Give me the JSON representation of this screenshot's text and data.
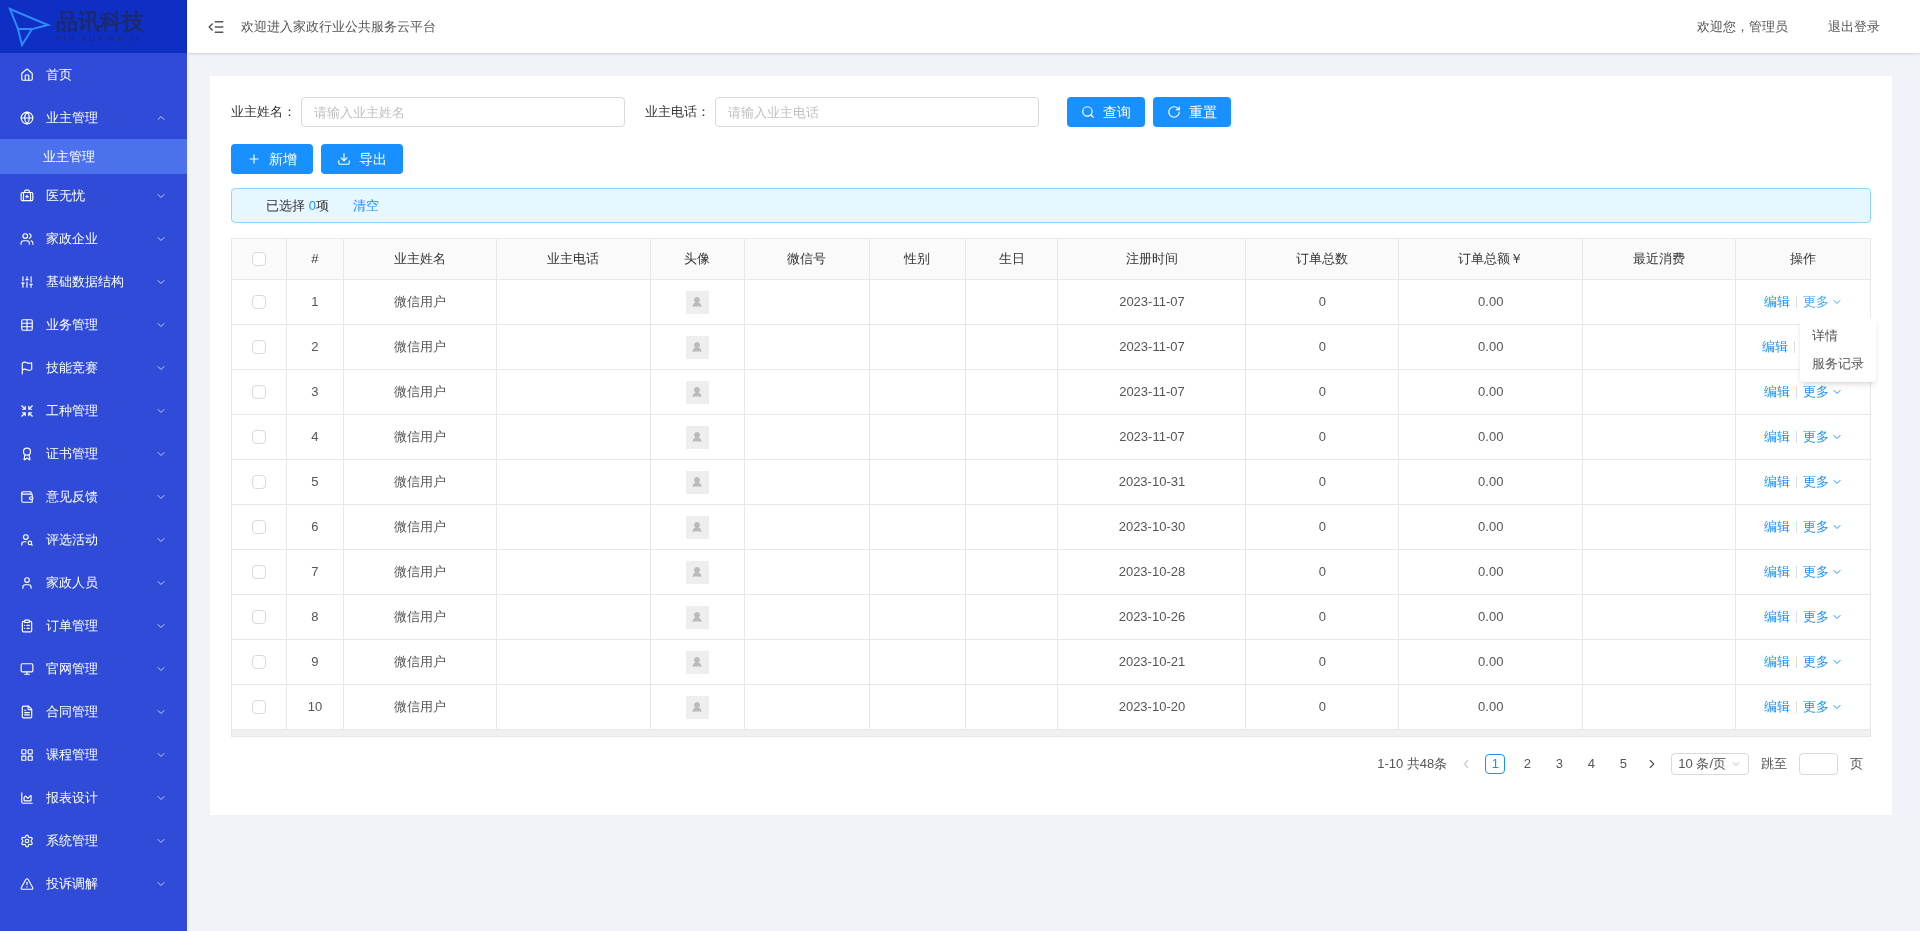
{
  "logo": {
    "name": "品讯科技",
    "subtitle": "PIN XUN KE JI"
  },
  "sidebar": {
    "items": [
      {
        "kind": "link",
        "label": "首页"
      },
      {
        "kind": "group",
        "label": "业主管理",
        "expanded": true,
        "children": [
          {
            "label": "业主管理",
            "selected": true
          }
        ]
      },
      {
        "kind": "group",
        "label": "医无忧",
        "expanded": false
      },
      {
        "kind": "group",
        "label": "家政企业",
        "expanded": false
      },
      {
        "kind": "group",
        "label": "基础数据结构",
        "expanded": false
      },
      {
        "kind": "group",
        "label": "业务管理",
        "expanded": false
      },
      {
        "kind": "group",
        "label": "技能竞赛",
        "expanded": false
      },
      {
        "kind": "group",
        "label": "工种管理",
        "expanded": false
      },
      {
        "kind": "group",
        "label": "证书管理",
        "expanded": false
      },
      {
        "kind": "group",
        "label": "意见反馈",
        "expanded": false
      },
      {
        "kind": "group",
        "label": "评选活动",
        "expanded": false
      },
      {
        "kind": "group",
        "label": "家政人员",
        "expanded": false
      },
      {
        "kind": "group",
        "label": "订单管理",
        "expanded": false
      },
      {
        "kind": "group",
        "label": "官网管理",
        "expanded": false
      },
      {
        "kind": "group",
        "label": "合同管理",
        "expanded": false
      },
      {
        "kind": "group",
        "label": "课程管理",
        "expanded": false
      },
      {
        "kind": "group",
        "label": "报表设计",
        "expanded": false
      },
      {
        "kind": "group",
        "label": "系统管理",
        "expanded": false
      },
      {
        "kind": "group",
        "label": "投诉调解",
        "expanded": false
      }
    ]
  },
  "header": {
    "title": "欢迎进入家政行业公共服务云平台",
    "greeting": "欢迎您，管理员",
    "logout": "退出登录"
  },
  "filters": [
    {
      "label": "业主姓名：",
      "placeholder": "请输入业主姓名"
    },
    {
      "label": "业主电话：",
      "placeholder": "请输入业主电话"
    }
  ],
  "search_buttons": [
    {
      "kind": "search",
      "label": "查询"
    },
    {
      "kind": "reset",
      "label": "重置"
    }
  ],
  "actions": [
    {
      "kind": "add",
      "label": "新增"
    },
    {
      "kind": "export",
      "label": "导出"
    }
  ],
  "selection": {
    "before": "已选择 ",
    "count": "0",
    "after": "项",
    "clear": "清空"
  },
  "table": {
    "columns": [
      "#",
      "业主姓名",
      "业主电话",
      "头像",
      "微信号",
      "性别",
      "生日",
      "注册时间",
      "订单总数",
      "订单总额￥",
      "最近消费",
      "操作"
    ],
    "all_checked": false,
    "more_menu": [
      "详情",
      "服务记录"
    ],
    "rows": [
      {
        "checked": false,
        "index": "1",
        "name": "微信用户",
        "registered": "2023-11-07",
        "orders": "0",
        "amount": "0.00",
        "edit": "编辑",
        "more": "更多",
        "menu_open": true
      },
      {
        "checked": false,
        "index": "2",
        "name": "微信用户",
        "registered": "2023-11-07",
        "orders": "0",
        "amount": "0.00",
        "edit": "编辑",
        "menu_open": false
      },
      {
        "checked": false,
        "index": "3",
        "name": "微信用户",
        "registered": "2023-11-07",
        "orders": "0",
        "amount": "0.00",
        "edit": "编辑",
        "more": "更多",
        "menu_open": false
      },
      {
        "checked": false,
        "index": "4",
        "name": "微信用户",
        "registered": "2023-11-07",
        "orders": "0",
        "amount": "0.00",
        "edit": "编辑",
        "more": "更多",
        "menu_open": false
      },
      {
        "checked": false,
        "index": "5",
        "name": "微信用户",
        "registered": "2023-10-31",
        "orders": "0",
        "amount": "0.00",
        "edit": "编辑",
        "more": "更多",
        "menu_open": false
      },
      {
        "checked": false,
        "index": "6",
        "name": "微信用户",
        "registered": "2023-10-30",
        "orders": "0",
        "amount": "0.00",
        "edit": "编辑",
        "more": "更多",
        "menu_open": false
      },
      {
        "checked": false,
        "index": "7",
        "name": "微信用户",
        "registered": "2023-10-28",
        "orders": "0",
        "amount": "0.00",
        "edit": "编辑",
        "more": "更多",
        "menu_open": false
      },
      {
        "checked": false,
        "index": "8",
        "name": "微信用户",
        "registered": "2023-10-26",
        "orders": "0",
        "amount": "0.00",
        "edit": "编辑",
        "more": "更多",
        "menu_open": false
      },
      {
        "checked": false,
        "index": "9",
        "name": "微信用户",
        "registered": "2023-10-21",
        "orders": "0",
        "amount": "0.00",
        "edit": "编辑",
        "more": "更多",
        "menu_open": false
      },
      {
        "checked": false,
        "index": "10",
        "name": "微信用户",
        "registered": "2023-10-20",
        "orders": "0",
        "amount": "0.00",
        "edit": "编辑",
        "more": "更多",
        "menu_open": false
      }
    ]
  },
  "pagination": {
    "total": "1-10 共48条",
    "pages": [
      {
        "label": "1",
        "selected": true
      },
      {
        "label": "2",
        "selected": false
      },
      {
        "label": "3",
        "selected": false
      },
      {
        "label": "4",
        "selected": false
      },
      {
        "label": "5",
        "selected": false
      }
    ],
    "page_size": "10 条/页",
    "jump": "跳至",
    "page_suffix": "页"
  }
}
